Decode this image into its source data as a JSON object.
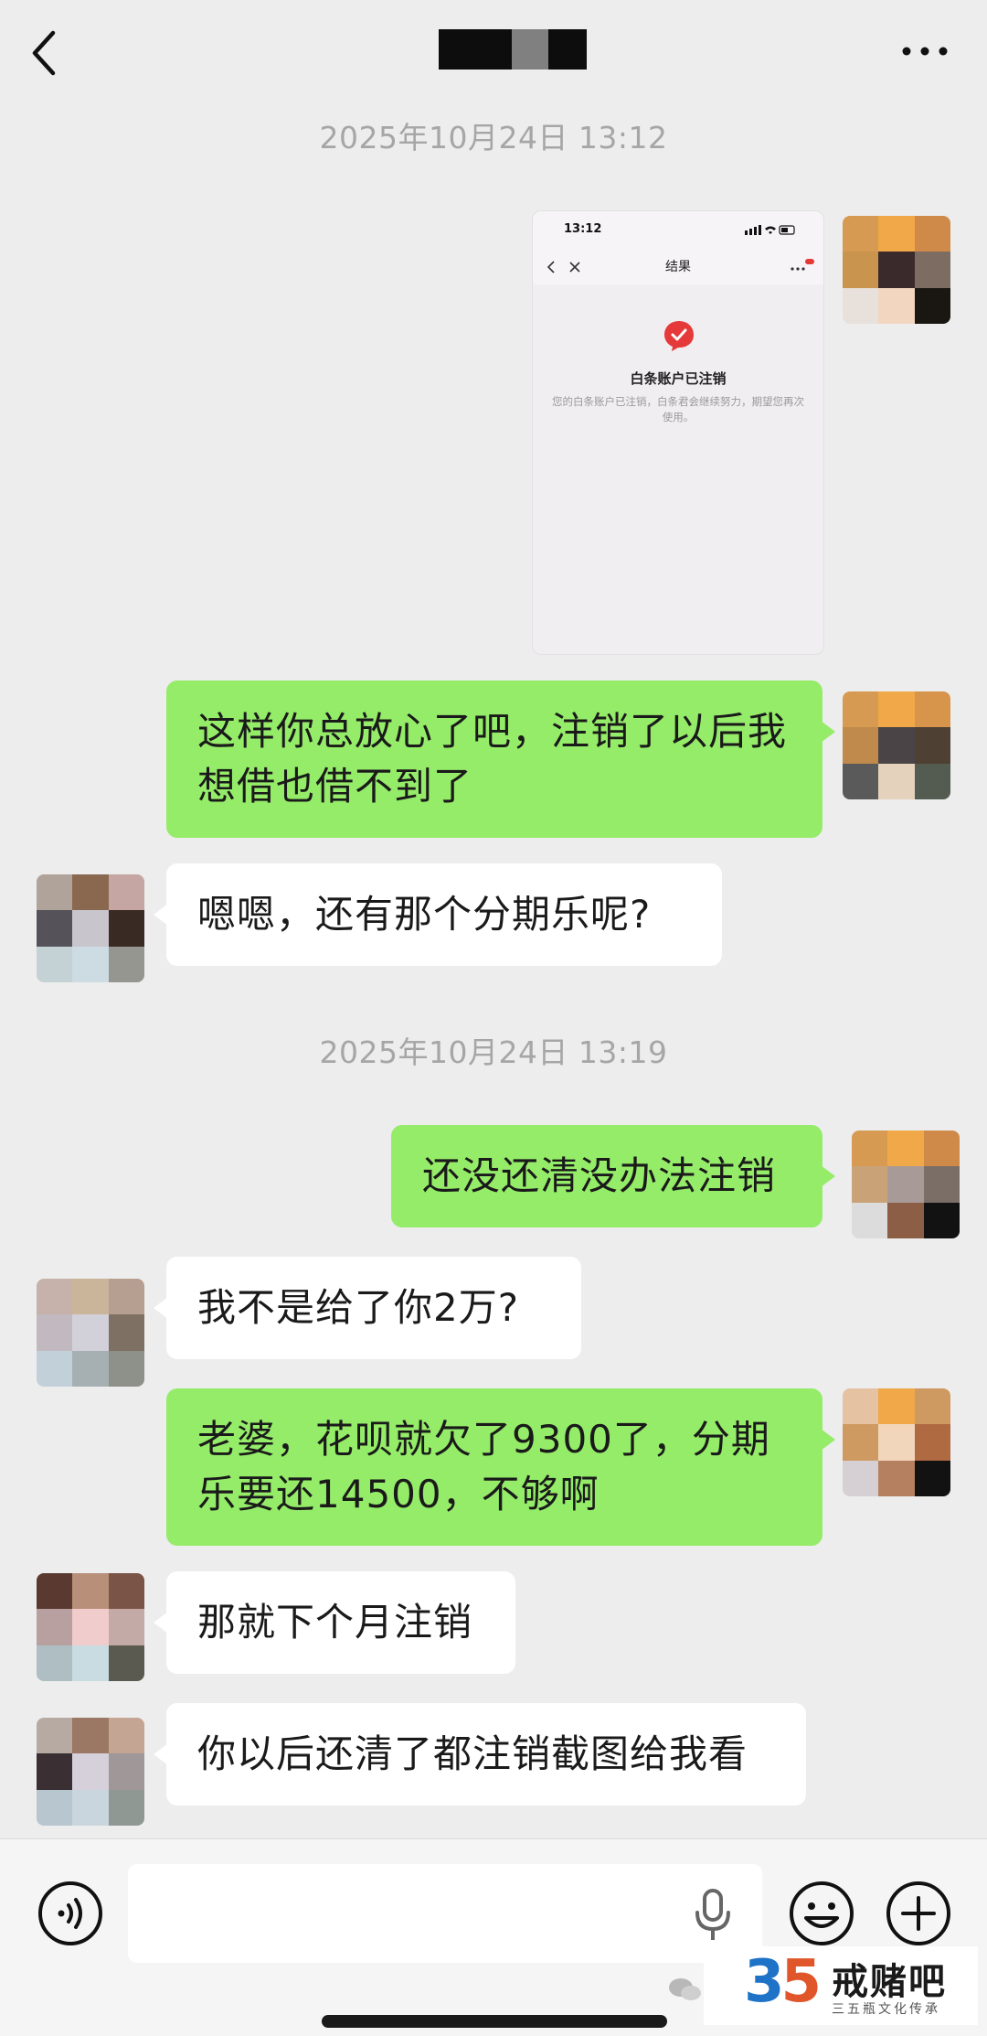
{
  "header": {
    "title": "",
    "back_icon": "chevron-left-icon",
    "more_icon": "more-horizontal-icon"
  },
  "timestamps": [
    "2025年10月24日 13:12",
    "2025年10月24日 13:19"
  ],
  "screenshot_message": {
    "status_time": "13:12",
    "page_title": "结果",
    "result_title": "白条账户已注销",
    "result_desc": "您的白条账户已注销，白条君会继续努力，期望您再次使用。"
  },
  "messages": [
    {
      "side": "me",
      "text": "这样你总放心了吧，注销了以后我想借也借不到了"
    },
    {
      "side": "them",
      "text": "嗯嗯，还有那个分期乐呢?"
    },
    {
      "side": "me",
      "text": "还没还清没办法注销"
    },
    {
      "side": "them",
      "text": "我不是给了你2万?"
    },
    {
      "side": "me",
      "text": "老婆，花呗就欠了9300了，分期乐要还14500，不够啊"
    },
    {
      "side": "them",
      "text": "那就下个月注销"
    },
    {
      "side": "them",
      "text": "你以后还清了都注销截图给我看"
    }
  ],
  "input_bar": {
    "voice_icon": "voice-icon",
    "mic_icon": "microphone-icon",
    "emoji_icon": "emoji-icon",
    "plus_icon": "plus-icon"
  },
  "watermark": {
    "number_a": "3",
    "number_b": "5",
    "name": "戒赌吧",
    "subtitle": "三五瓶文化传承"
  },
  "colors": {
    "my_bubble": "#95ec69",
    "their_bubble": "#ffffff",
    "background": "#ededed"
  }
}
